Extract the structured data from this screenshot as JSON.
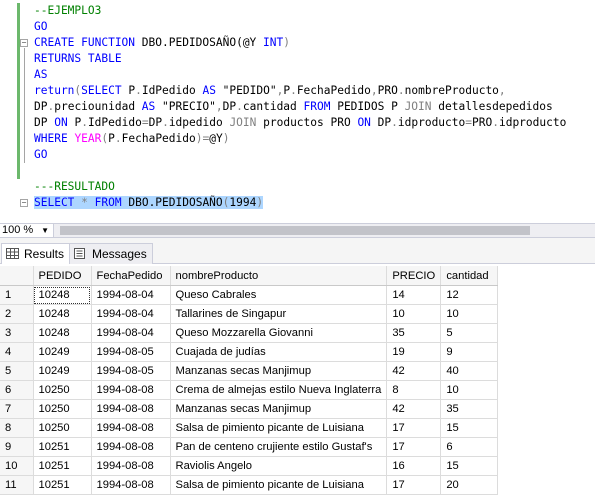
{
  "editor": {
    "lines": [
      [
        {
          "t": "--EJEMPLO3",
          "c": "cm"
        }
      ],
      [
        {
          "t": "GO",
          "c": "kw"
        }
      ],
      [
        {
          "t": "CREATE FUNCTION",
          "c": "kw"
        },
        {
          "t": " DBO.PEDIDOSAÑO(@Y ",
          "c": ""
        },
        {
          "t": "INT",
          "c": "kw"
        },
        {
          "t": ")",
          "c": "gray"
        }
      ],
      [
        {
          "t": "RETURNS TABLE",
          "c": "kw"
        }
      ],
      [
        {
          "t": "AS",
          "c": "kw"
        }
      ],
      [
        {
          "t": "return",
          "c": "kw"
        },
        {
          "t": "(",
          "c": "gray"
        },
        {
          "t": "SELECT",
          "c": "kw"
        },
        {
          "t": " P",
          "c": ""
        },
        {
          "t": ".",
          "c": "gray"
        },
        {
          "t": "IdPedido ",
          "c": ""
        },
        {
          "t": "AS",
          "c": "kw"
        },
        {
          "t": " \"PEDIDO\"",
          "c": ""
        },
        {
          "t": ",",
          "c": "gray"
        },
        {
          "t": "P",
          "c": ""
        },
        {
          "t": ".",
          "c": "gray"
        },
        {
          "t": "FechaPedido",
          "c": ""
        },
        {
          "t": ",",
          "c": "gray"
        },
        {
          "t": "PRO",
          "c": ""
        },
        {
          "t": ".",
          "c": "gray"
        },
        {
          "t": "nombreProducto",
          "c": ""
        },
        {
          "t": ",",
          "c": "gray"
        }
      ],
      [
        {
          "t": "DP",
          "c": ""
        },
        {
          "t": ".",
          "c": "gray"
        },
        {
          "t": "preciounidad ",
          "c": ""
        },
        {
          "t": "AS",
          "c": "kw"
        },
        {
          "t": " \"PRECIO\"",
          "c": ""
        },
        {
          "t": ",",
          "c": "gray"
        },
        {
          "t": "DP",
          "c": ""
        },
        {
          "t": ".",
          "c": "gray"
        },
        {
          "t": "cantidad ",
          "c": ""
        },
        {
          "t": "FROM",
          "c": "kw"
        },
        {
          "t": " PEDIDOS P ",
          "c": ""
        },
        {
          "t": "JOIN",
          "c": "gray"
        },
        {
          "t": " detallesdepedidos",
          "c": ""
        }
      ],
      [
        {
          "t": "DP ",
          "c": ""
        },
        {
          "t": "ON",
          "c": "kw"
        },
        {
          "t": " P",
          "c": ""
        },
        {
          "t": ".",
          "c": "gray"
        },
        {
          "t": "IdPedido",
          "c": ""
        },
        {
          "t": "=",
          "c": "gray"
        },
        {
          "t": "DP",
          "c": ""
        },
        {
          "t": ".",
          "c": "gray"
        },
        {
          "t": "idpedido ",
          "c": ""
        },
        {
          "t": "JOIN",
          "c": "gray"
        },
        {
          "t": " productos PRO ",
          "c": ""
        },
        {
          "t": "ON",
          "c": "kw"
        },
        {
          "t": " DP",
          "c": ""
        },
        {
          "t": ".",
          "c": "gray"
        },
        {
          "t": "idproducto",
          "c": ""
        },
        {
          "t": "=",
          "c": "gray"
        },
        {
          "t": "PRO",
          "c": ""
        },
        {
          "t": ".",
          "c": "gray"
        },
        {
          "t": "idproducto",
          "c": ""
        }
      ],
      [
        {
          "t": "WHERE",
          "c": "kw"
        },
        {
          "t": " ",
          "c": ""
        },
        {
          "t": "YEAR",
          "c": "fn"
        },
        {
          "t": "(",
          "c": "gray"
        },
        {
          "t": "P",
          "c": ""
        },
        {
          "t": ".",
          "c": "gray"
        },
        {
          "t": "FechaPedido",
          "c": ""
        },
        {
          "t": ")=",
          "c": "gray"
        },
        {
          "t": "@Y",
          "c": ""
        },
        {
          "t": ")",
          "c": "gray"
        }
      ],
      [
        {
          "t": "GO",
          "c": "kw"
        }
      ],
      [],
      [
        {
          "t": "---RESULTADO",
          "c": "cm"
        }
      ],
      [
        {
          "t": "SELECT",
          "c": "kw sel"
        },
        {
          "t": " ",
          "c": "sel"
        },
        {
          "t": "*",
          "c": "gray sel"
        },
        {
          "t": " ",
          "c": "sel"
        },
        {
          "t": "FROM",
          "c": "kw sel"
        },
        {
          "t": " DBO.PEDIDOSAÑO",
          "c": "sel"
        },
        {
          "t": "(",
          "c": "gray sel"
        },
        {
          "t": "1994",
          "c": "sel"
        },
        {
          "t": ")",
          "c": "gray sel"
        }
      ]
    ]
  },
  "zoom": {
    "value": "100 %"
  },
  "tabs": [
    {
      "label": "Results",
      "active": true
    },
    {
      "label": "Messages",
      "active": false
    }
  ],
  "results": {
    "columns": [
      "PEDIDO",
      "FechaPedido",
      "nombreProducto",
      "PRECIO",
      "cantidad"
    ],
    "rows": [
      [
        "1",
        "10248",
        "1994-08-04",
        "Queso Cabrales",
        "14",
        "12"
      ],
      [
        "2",
        "10248",
        "1994-08-04",
        "Tallarines de Singapur",
        "10",
        "10"
      ],
      [
        "3",
        "10248",
        "1994-08-04",
        "Queso Mozzarella Giovanni",
        "35",
        "5"
      ],
      [
        "4",
        "10249",
        "1994-08-05",
        "Cuajada de judías",
        "19",
        "9"
      ],
      [
        "5",
        "10249",
        "1994-08-05",
        "Manzanas secas Manjimup",
        "42",
        "40"
      ],
      [
        "6",
        "10250",
        "1994-08-08",
        "Crema de almejas estilo Nueva Inglaterra",
        "8",
        "10"
      ],
      [
        "7",
        "10250",
        "1994-08-08",
        "Manzanas secas Manjimup",
        "42",
        "35"
      ],
      [
        "8",
        "10250",
        "1994-08-08",
        "Salsa de pimiento picante de Luisiana",
        "17",
        "15"
      ],
      [
        "9",
        "10251",
        "1994-08-08",
        "Pan de centeno crujiente estilo Gustaf's",
        "17",
        "6"
      ],
      [
        "10",
        "10251",
        "1994-08-08",
        "Raviolis Angelo",
        "16",
        "15"
      ],
      [
        "11",
        "10251",
        "1994-08-08",
        "Salsa de pimiento picante de Luisiana",
        "17",
        "20"
      ]
    ]
  }
}
